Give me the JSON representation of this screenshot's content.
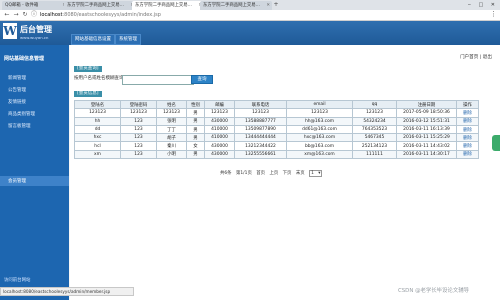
{
  "browser": {
    "tabs": [
      {
        "label": "QQ邮箱 - 收件箱",
        "active": false
      },
      {
        "label": "东方学院二手商品网上交易...",
        "active": false
      },
      {
        "label": "东方学院二手商品网上交易...",
        "active": true
      },
      {
        "label": "东方学院二手商品网上交易...",
        "active": false
      }
    ],
    "url_host": "localhost",
    "url_path": ":8080/eastschoolesyys/admin/index.jsp",
    "window_controls": "‒ □ ✕"
  },
  "app": {
    "logo_letter": "W",
    "brand_title": "后台管理",
    "brand_url": "www.wuyan.cn",
    "system_buttons": [
      "网站基础信息设置",
      "系统管理"
    ]
  },
  "sidebar": {
    "title": "网站基础信息管理",
    "items": [
      "新闻管理",
      "公告管理",
      "友情链接",
      "商品类别管理",
      "留言板管理",
      "会员管理"
    ],
    "active_index": 5,
    "footer": "访问前台网站"
  },
  "content": {
    "top_links": "门户首页 | 退出",
    "search_panel": {
      "title": "[会员查询]",
      "label": "按用户名或姓名模糊查询:",
      "input_value": "",
      "button_label": "查询"
    },
    "list_panel": {
      "title": "[会员信息]"
    },
    "table": {
      "headers": [
        "登陆名",
        "登陆密码",
        "姓名",
        "性别",
        "邮编",
        "联系电话",
        "email",
        "qq",
        "注册日期",
        "操作"
      ],
      "rows": [
        [
          "123123",
          "123123",
          "123123",
          "男",
          "123123",
          "123123",
          "123123",
          "123123",
          "2017-05-09 18:50:36",
          "删除"
        ],
        [
          "hh",
          "123",
          "张明",
          "男",
          "430000",
          "13588887777",
          "hh@163.com",
          "54324234",
          "2016-03-12 15:51:31",
          "删除"
        ],
        [
          "dd",
          "123",
          "丁丁",
          "男",
          "410000",
          "13509877890",
          "dd61@163.com",
          "764353523",
          "2016-03-11 16:13:39",
          "删除"
        ],
        [
          "hxc",
          "123",
          "胡子",
          "男",
          "410000",
          "13444444444",
          "hxc@163.com",
          "5467345",
          "2016-03-11 15:25:29",
          "删除"
        ],
        [
          "hcl",
          "123",
          "秦川",
          "女",
          "430000",
          "13212344422",
          "bb@163.com",
          "252134123",
          "2016-03-11 14:43:02",
          "删除"
        ],
        [
          "xm",
          "123",
          "小明",
          "男",
          "430000",
          "13255556661",
          "xm@163.com",
          "111111",
          "2016-03-11 14:30:17",
          "删除"
        ]
      ]
    },
    "pager": {
      "total": "共6条",
      "page_info": "第1/1页",
      "first": "首页",
      "prev": "上页",
      "next": "下页",
      "last": "末页",
      "current_page": "1"
    }
  },
  "status_bar": "localhost:8080/eastschoolesyys/admin/member.jsp",
  "watermark": "CSDN @老学长毕设论文辅导"
}
